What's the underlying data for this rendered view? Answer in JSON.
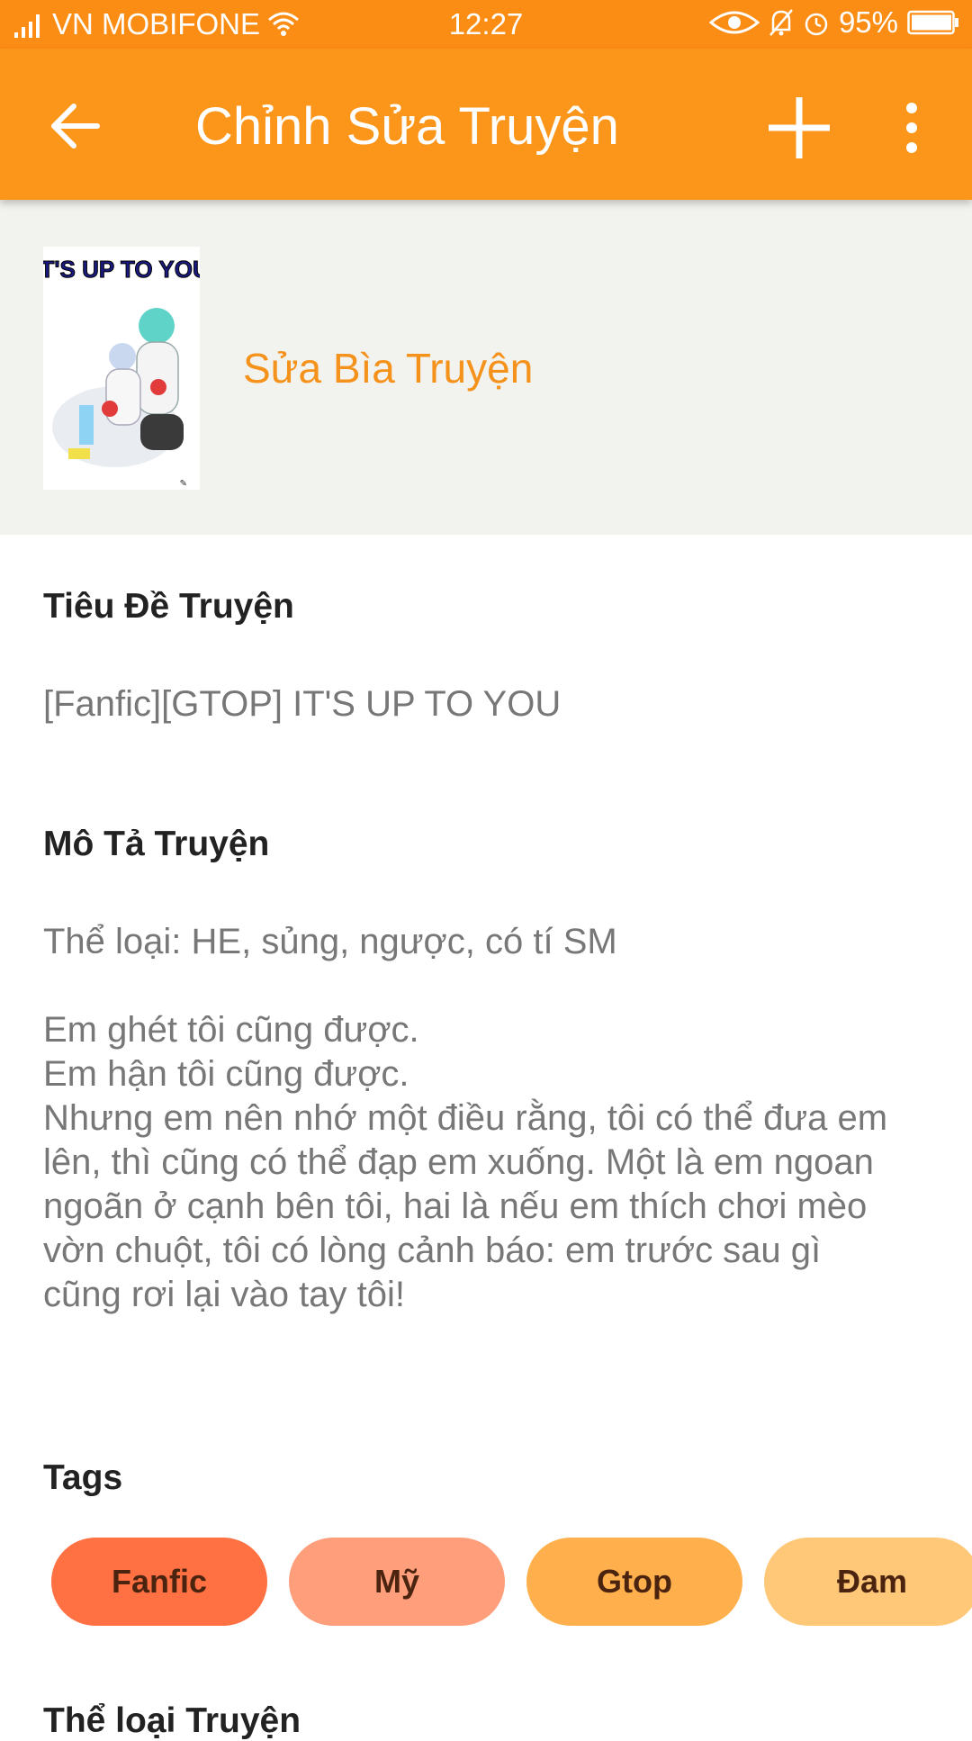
{
  "status_bar": {
    "carrier": "VN MOBIFONE",
    "time": "12:27",
    "battery": "95%",
    "icons": [
      "signal-icon",
      "wifi-icon",
      "eye-icon",
      "bell-off-icon",
      "alarm-icon",
      "battery-icon"
    ]
  },
  "appbar": {
    "title": "Chỉnh Sửa Truyện",
    "icons": [
      "back-arrow-icon",
      "plus-icon",
      "more-vert-icon"
    ]
  },
  "cover": {
    "image_title_text": "IT'S UP TO YOU",
    "edit_label": "Sửa Bìa Truyện"
  },
  "story_title": {
    "label": "Tiêu Đề Truyện",
    "value": "[Fanfic][GTOP] IT'S UP TO YOU"
  },
  "description": {
    "label": "Mô Tả Truyện",
    "genre_line": "Thể loại: HE, sủng, ngược, có tí SM",
    "lines": [
      "Em ghét tôi cũng được.",
      "Em hận tôi cũng được.",
      "Nhưng em nên nhớ một điều rằng, tôi có thể đưa em",
      "lên, thì cũng có thể đạp em xuống. Một là em ngoan",
      "ngoãn ở cạnh bên tôi, hai là nếu em thích chơi mèo",
      "vờn chuột, tôi có lòng cảnh báo: em trước sau gì",
      "cũng rơi lại vào tay tôi!"
    ]
  },
  "tags": {
    "label": "Tags",
    "items": [
      {
        "label": "Fanfic",
        "color": "#ff7043"
      },
      {
        "label": "Mỹ",
        "color": "#ff9e7a"
      },
      {
        "label": "Gtop",
        "color": "#ffb04c"
      },
      {
        "label": "Đam",
        "color": "#ffc878"
      }
    ]
  },
  "next_section": {
    "label": "Thể loại Truyện"
  },
  "colors": {
    "status_bar": "#fb8c14",
    "appbar": "#fb961a",
    "accent": "#f5921b"
  }
}
